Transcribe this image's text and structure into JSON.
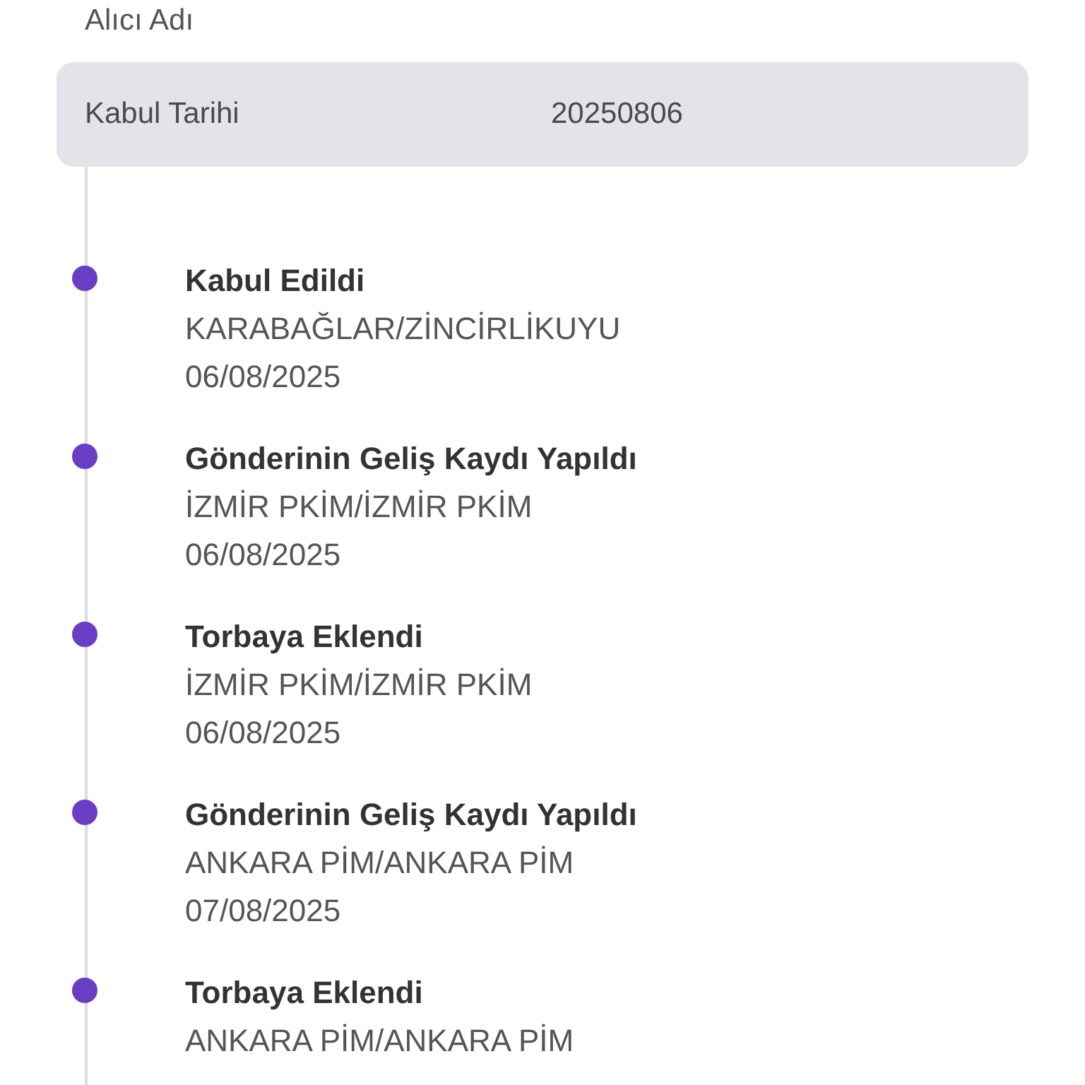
{
  "receiver_label": "Alıcı Adı",
  "info": {
    "label": "Kabul Tarihi",
    "value": "20250806"
  },
  "events": [
    {
      "title": "Kabul Edildi",
      "location": "KARABAĞLAR/ZİNCİRLİKUYU",
      "date": "06/08/2025"
    },
    {
      "title": "Gönderinin Geliş Kaydı Yapıldı",
      "location": "İZMİR PKİM/İZMİR PKİM",
      "date": "06/08/2025"
    },
    {
      "title": "Torbaya Eklendi",
      "location": "İZMİR PKİM/İZMİR PKİM",
      "date": "06/08/2025"
    },
    {
      "title": "Gönderinin Geliş Kaydı Yapıldı",
      "location": "ANKARA PİM/ANKARA PİM",
      "date": "07/08/2025"
    },
    {
      "title": "Torbaya Eklendi",
      "location": "ANKARA PİM/ANKARA PİM"
    }
  ]
}
